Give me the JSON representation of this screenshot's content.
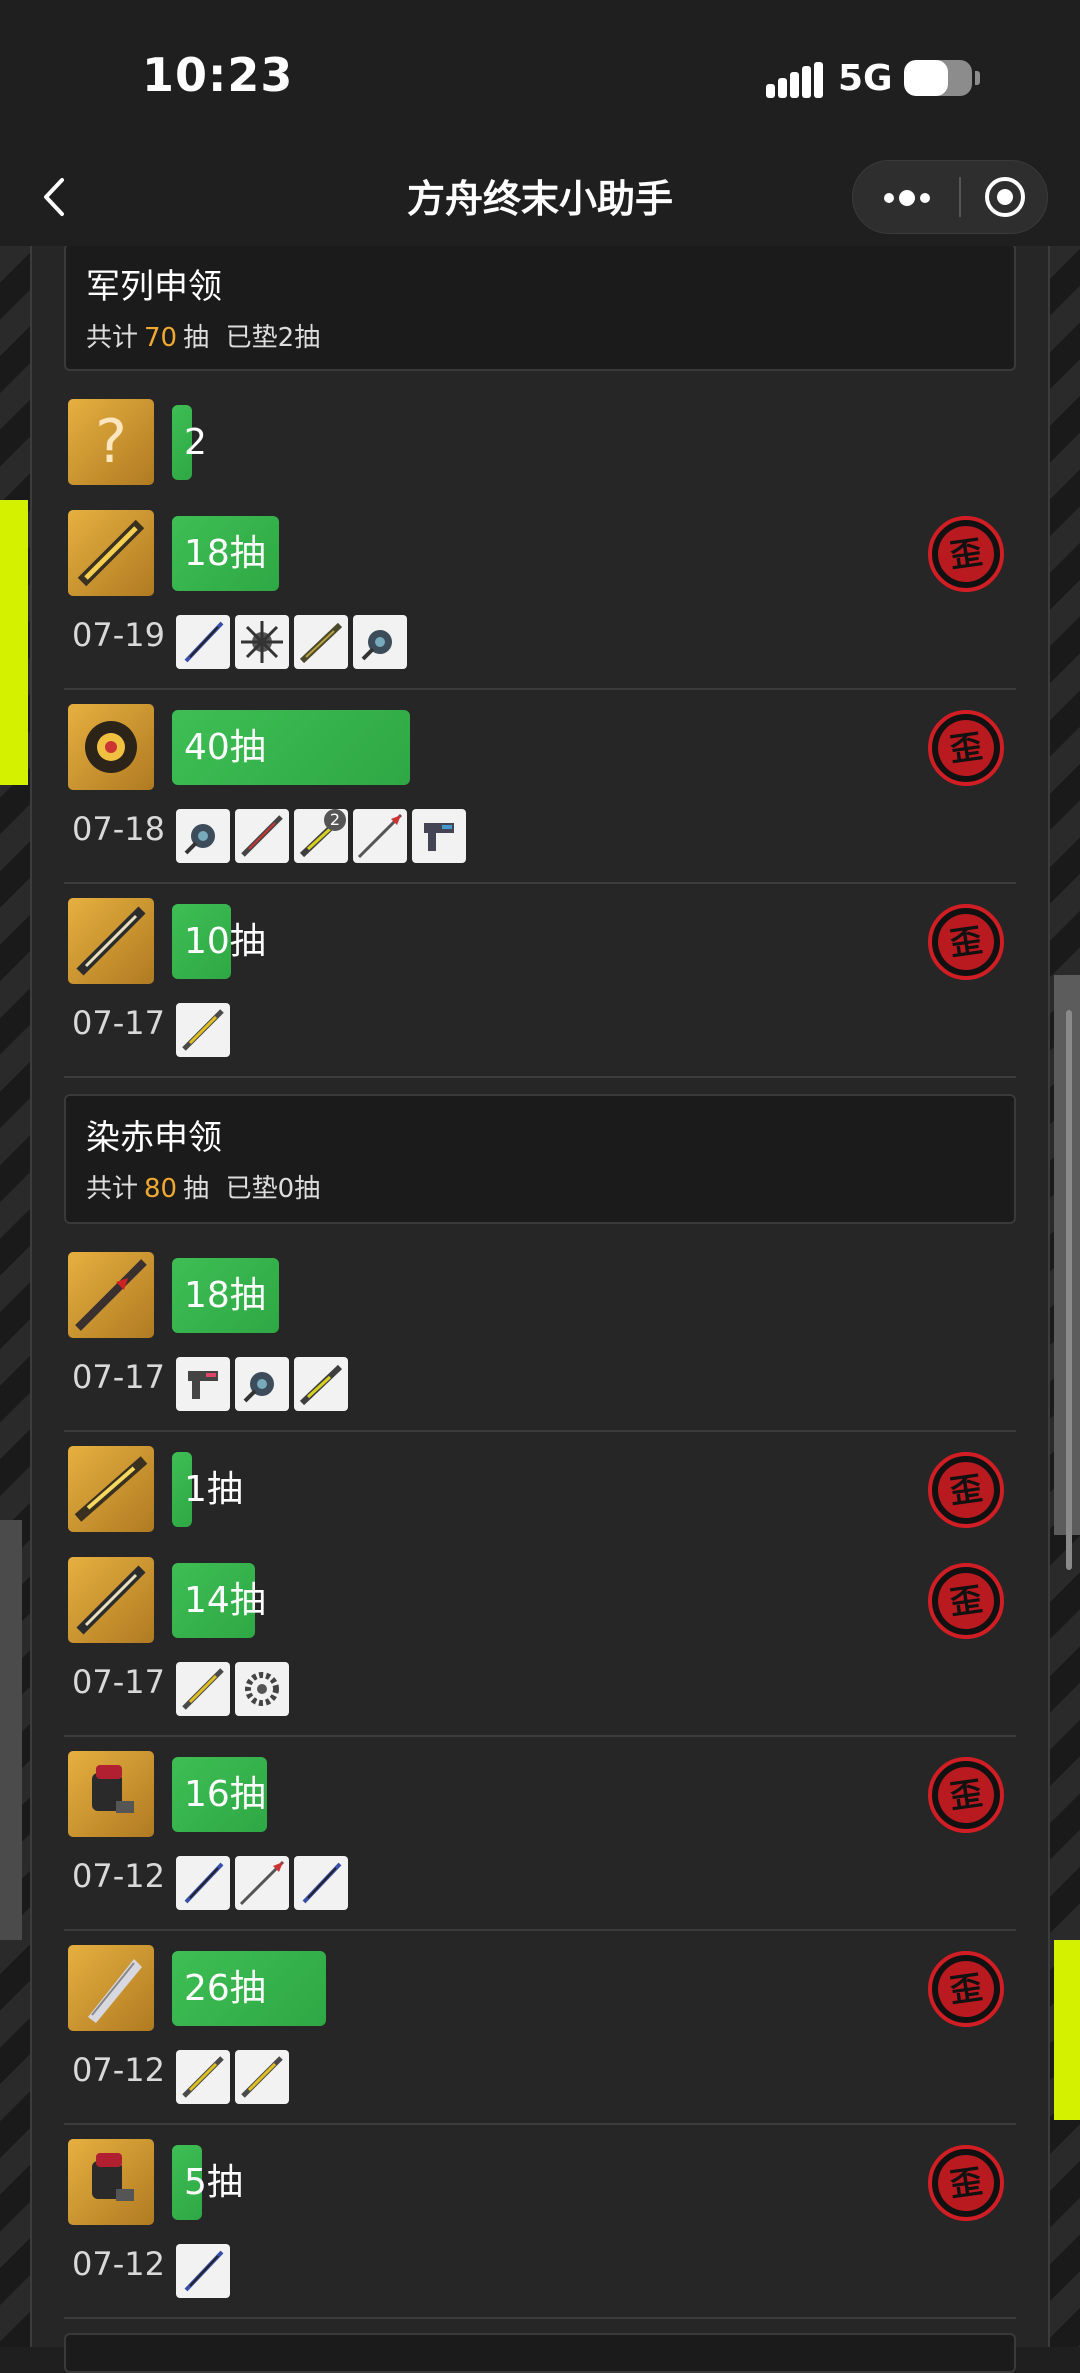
{
  "status_bar": {
    "time": "10:23",
    "network": "5G",
    "battery_level": 0.65
  },
  "nav": {
    "title": "方舟终末小助手"
  },
  "pools": [
    {
      "name": "军列申领",
      "stats_prefix": "共计",
      "total": "70",
      "stats_unit": "抽",
      "stats_suffix": "已垫2抽",
      "records": [
        {
          "bar_label": "2",
          "pulls": 2,
          "date": "",
          "items": [],
          "wai": false,
          "avatar": "question-mark"
        },
        {
          "bar_label": "18抽",
          "pulls": 18,
          "date": "07-19",
          "items": [
            "sword-blue",
            "spiked-mace",
            "rifle",
            "gear-device"
          ],
          "wai": true,
          "avatar": "golden-cannon"
        },
        {
          "bar_label": "40抽",
          "pulls": 40,
          "date": "07-18",
          "items": [
            "gear-device",
            "blade-red",
            "rifle-yellow",
            "spear-red",
            "pistol-blue"
          ],
          "item_badge": "2",
          "wai": true,
          "avatar": "golden-armor"
        },
        {
          "bar_label": "10抽",
          "pulls": 10,
          "date": "07-17",
          "items": [
            "blade-yellow"
          ],
          "wai": true,
          "avatar": "golden-blade"
        }
      ]
    },
    {
      "name": "染赤申领",
      "stats_prefix": "共计",
      "total": "80",
      "stats_unit": "抽",
      "stats_suffix": "已垫0抽",
      "records": [
        {
          "bar_label": "18抽",
          "pulls": 18,
          "date": "07-17",
          "items": [
            "pistol-pink",
            "gear-device",
            "rifle-yellow"
          ],
          "wai": false,
          "avatar": "red-lance"
        },
        {
          "bar_label": "1抽",
          "pulls": 1,
          "date": "",
          "items": [],
          "wai": true,
          "avatar": "golden-rifle"
        },
        {
          "bar_label": "14抽",
          "pulls": 14,
          "date": "07-17",
          "items": [
            "blade-yellow",
            "chain-disc"
          ],
          "wai": true,
          "avatar": "golden-blade"
        },
        {
          "bar_label": "16抽",
          "pulls": 16,
          "date": "07-12",
          "items": [
            "sword-blue",
            "spear-red",
            "sword-blue"
          ],
          "wai": true,
          "avatar": "red-gauntlet"
        },
        {
          "bar_label": "26抽",
          "pulls": 26,
          "date": "07-12",
          "items": [
            "blade-yellow",
            "blade-yellow"
          ],
          "wai": true,
          "avatar": "silver-greatsword"
        },
        {
          "bar_label": "5抽",
          "pulls": 5,
          "date": "07-12",
          "items": [
            "sword-blue"
          ],
          "wai": true,
          "avatar": "red-gauntlet"
        }
      ]
    }
  ],
  "wai_label": "歪",
  "colors": {
    "bar": "#3fbe55",
    "accent_number": "#f0a830",
    "wai_ring": "#d11e25",
    "lime": "#d4f200"
  },
  "icons": [
    "back-chevron-icon",
    "more-dots-icon",
    "target-circle-icon",
    "signal-bars-icon",
    "battery-icon"
  ]
}
